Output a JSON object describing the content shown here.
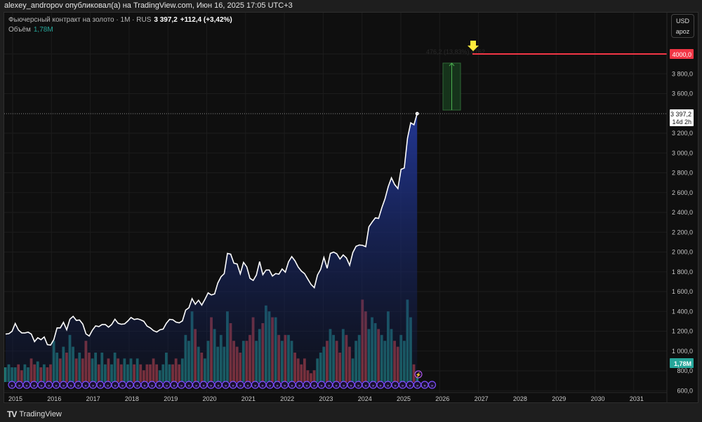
{
  "header": {
    "publish_line": "alexey_andropov опубликовал(а) на TradingView.com, Июн 16, 2025 17:05 UTC+3"
  },
  "legend": {
    "symbol": "Фьючерсный контракт на золото · 1M · RUS",
    "last": "3 397,2",
    "change": "+112,4 (+3,42%)",
    "volume_label": "Объём",
    "volume_value": "1,78M"
  },
  "currency_box": {
    "currency": "USD",
    "mode": "apoz"
  },
  "price_axis": {
    "ticks": [
      "3 800,0",
      "3 600,0",
      "3 200,0",
      "3 000,0",
      "2 800,0",
      "2 600,0",
      "2 400,0",
      "2 200,0",
      "2 000,0",
      "1 800,0",
      "1 600,0",
      "1 400,0",
      "1 200,0",
      "1 000,0",
      "800,0",
      "600,0"
    ],
    "tick_values": [
      3800,
      3600,
      3200,
      3000,
      2800,
      2600,
      2400,
      2200,
      2000,
      1800,
      1600,
      1400,
      1200,
      1000,
      800,
      600
    ],
    "last_price_label": "3 397,2",
    "countdown": "14d 2h",
    "target_label": "4000,0",
    "volume_badge": "1,78M"
  },
  "time_axis": {
    "labels": [
      "2015",
      "2016",
      "2017",
      "2018",
      "2019",
      "2020",
      "2021",
      "2022",
      "2023",
      "2024",
      "2025",
      "2026",
      "2027",
      "2028",
      "2029",
      "2030",
      "2031"
    ]
  },
  "annotations": {
    "measure_text": "476,2 (13,83%) 4762",
    "target_price": 4000,
    "colors": {
      "target": "#f23645",
      "arrow": "#ffeb3b",
      "measure": "#4caf50",
      "marker": "#7c4dff"
    }
  },
  "footer": {
    "brand": "TradingView"
  },
  "chart_data": {
    "type": "area",
    "start": "2014-10",
    "interval": "1M",
    "close": [
      1171,
      1175,
      1199,
      1278,
      1212,
      1183,
      1183,
      1190,
      1172,
      1095,
      1134,
      1114,
      1142,
      1064,
      1060,
      1116,
      1234,
      1233,
      1290,
      1215,
      1322,
      1350,
      1309,
      1313,
      1272,
      1173,
      1151,
      1211,
      1254,
      1247,
      1268,
      1268,
      1241,
      1268,
      1321,
      1280,
      1270,
      1274,
      1303,
      1339,
      1318,
      1325,
      1315,
      1300,
      1252,
      1233,
      1206,
      1192,
      1214,
      1222,
      1281,
      1320,
      1316,
      1292,
      1285,
      1305,
      1413,
      1437,
      1529,
      1472,
      1513,
      1464,
      1523,
      1587,
      1566,
      1577,
      1687,
      1751,
      1781,
      1986,
      1978,
      1887,
      1879,
      1780,
      1895,
      1850,
      1734,
      1713,
      1768,
      1903,
      1771,
      1817,
      1818,
      1757,
      1783,
      1776,
      1829,
      1796,
      1900,
      1954,
      1911,
      1848,
      1807,
      1781,
      1726,
      1672,
      1640,
      1768,
      1826,
      1945,
      1836,
      1986,
      1999,
      1982,
      1929,
      1970,
      1940,
      1866,
      1994,
      2057,
      2071,
      2067,
      2054,
      2254,
      2302,
      2345,
      2339,
      2447,
      2536,
      2659,
      2749,
      2681,
      2641,
      2835,
      2848,
      3150,
      3305,
      3285,
      3397.2
    ],
    "volume_millions": [
      2.5,
      3,
      2.5,
      2.5,
      3,
      2,
      3,
      2.5,
      4,
      3,
      3.5,
      2.5,
      3,
      2.5,
      3,
      7,
      5,
      4,
      6,
      5,
      8,
      6,
      4,
      5,
      4,
      7,
      5,
      4,
      5,
      3,
      5,
      3,
      4,
      3,
      5,
      4,
      3,
      4,
      3,
      4,
      3,
      4,
      3,
      2,
      3,
      3,
      4,
      3,
      2,
      3,
      5,
      3,
      3,
      4,
      3,
      4,
      8,
      7,
      12,
      9,
      6,
      5,
      4,
      7,
      11,
      9,
      6,
      8,
      6,
      12,
      10,
      7,
      6,
      5,
      7,
      7,
      8,
      11,
      7,
      9,
      10,
      13,
      12,
      11,
      11,
      8,
      7,
      8,
      8,
      7,
      5,
      4,
      3,
      4,
      2,
      1.5,
      2,
      4,
      5,
      6,
      7,
      9,
      8,
      7,
      5,
      9,
      8,
      6,
      4,
      7,
      8,
      14,
      12,
      9,
      11,
      10,
      9,
      8,
      7,
      12,
      9,
      7,
      6,
      8,
      7,
      14,
      11,
      3,
      1.78
    ],
    "ylim": [
      600,
      4000
    ]
  }
}
